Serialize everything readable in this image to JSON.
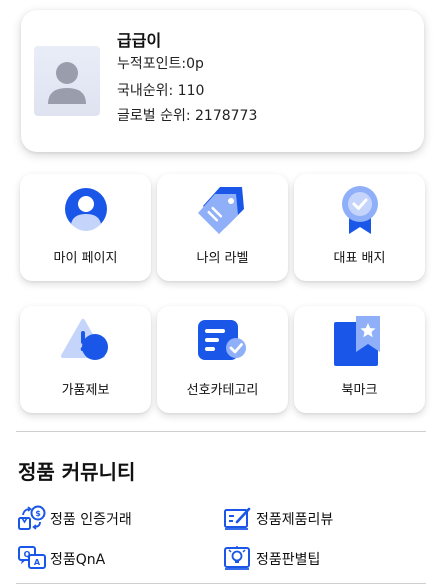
{
  "profile": {
    "name": "급급이",
    "points": "누적포인트:0p",
    "domestic_rank": "국내순위:  110",
    "global_rank": "글로벌 순위:  2178773"
  },
  "menu": {
    "my_page": "마이 페이지",
    "my_label": "나의 라벨",
    "badge": "대표 배지",
    "report": "가품제보",
    "category": "선호카테고리",
    "bookmark": "북마크"
  },
  "community": {
    "title": "정품 커뮤니티",
    "trade": "정품 인증거래",
    "review": "정품제품리뷰",
    "qna": "정품QnA",
    "tip": "정품판별팁"
  },
  "colors": {
    "primary": "#1a56e8",
    "light": "#6f96f5",
    "pale": "#c4d4fb"
  },
  "icons": {
    "avatar": "person-silhouette",
    "my_page": "user-icon",
    "my_label": "tag-icon",
    "badge": "ribbon-badge-icon",
    "report": "warning-triangle-icon",
    "category": "document-check-icon",
    "bookmark": "bookmark-star-icon",
    "trade": "exchange-icon",
    "review": "review-pen-icon",
    "qna": "qna-chat-icon",
    "tip": "lightbulb-icon"
  }
}
